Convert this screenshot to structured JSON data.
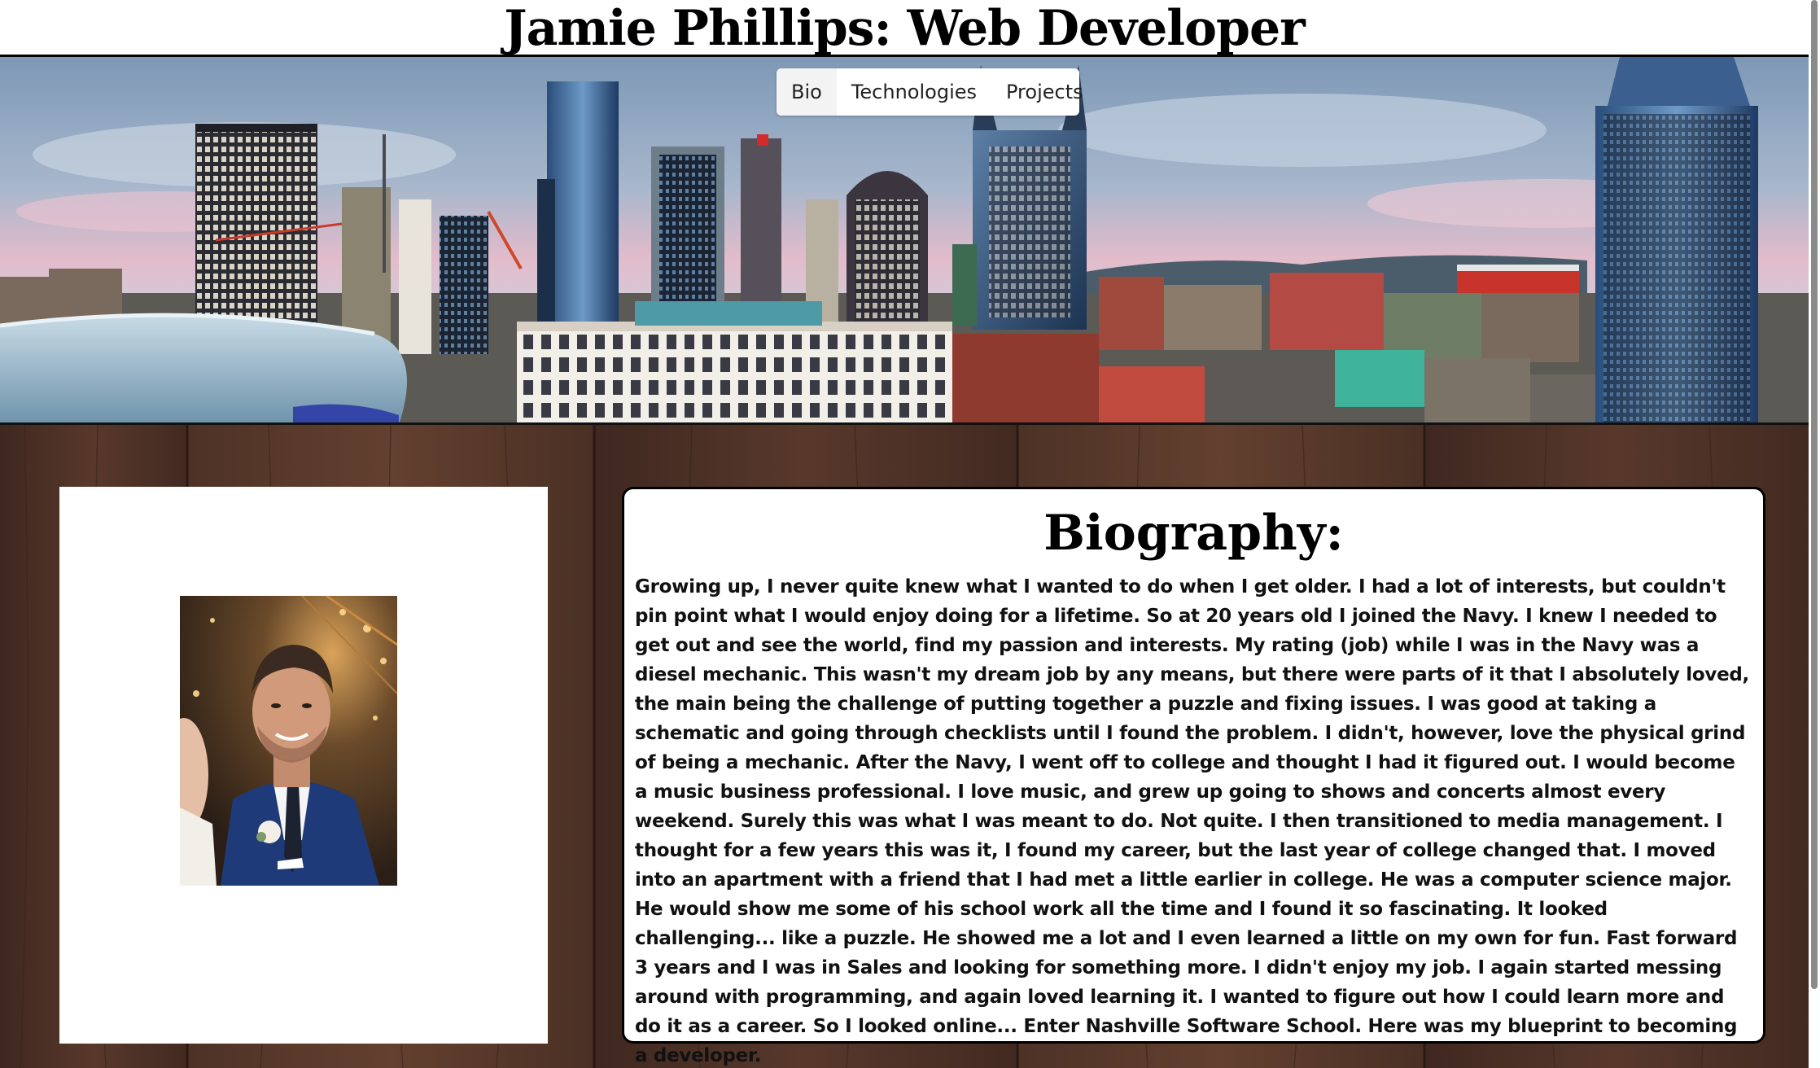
{
  "header": {
    "title": "Jamie Phillips: Web Developer"
  },
  "nav": {
    "items": [
      {
        "label": "Bio"
      },
      {
        "label": "Technologies"
      },
      {
        "label": "Projects"
      }
    ]
  },
  "bio": {
    "heading": "Biography:",
    "text": "Growing up, I never quite knew what I wanted to do when I get older. I had a lot of interests, but couldn't pin point what I would enjoy doing for a lifetime. So at 20 years old I joined the Navy. I knew I needed to get out and see the world, find my passion and interests. My rating (job) while I was in the Navy was a diesel mechanic. This wasn't my dream job by any means, but there were parts of it that I absolutely loved, the main being the challenge of putting together a puzzle and fixing issues. I was good at taking a schematic and going through checklists until I found the problem. I didn't, however, love the physical grind of being a mechanic. After the Navy, I went off to college and thought I had it figured out. I would become a music business professional. I love music, and grew up going to shows and concerts almost every weekend. Surely this was what I was meant to do. Not quite. I then transitioned to media management. I thought for a few years this was it, I found my career, but the last year of college changed that. I moved into an apartment with a friend that I had met a little earlier in college. He was a computer science major. He would show me some of his school work all the time and I found it so fascinating. It looked challenging... like a puzzle. He showed me a lot and I even learned a little on my own for fun. Fast forward 3 years and I was in Sales and looking for something more. I didn't enjoy my job. I again started messing around with programming, and again loved learning it. I wanted to figure out how I could learn more and do it as a career. So I looked online... Enter Nashville Software School. Here was my blueprint to becoming a developer."
  },
  "colors": {
    "wood": "#4a2f24",
    "card_bg": "#ffffff",
    "text": "#111111",
    "sky_top": "#6f8fb0",
    "sky_pink": "#e8b9c6"
  }
}
